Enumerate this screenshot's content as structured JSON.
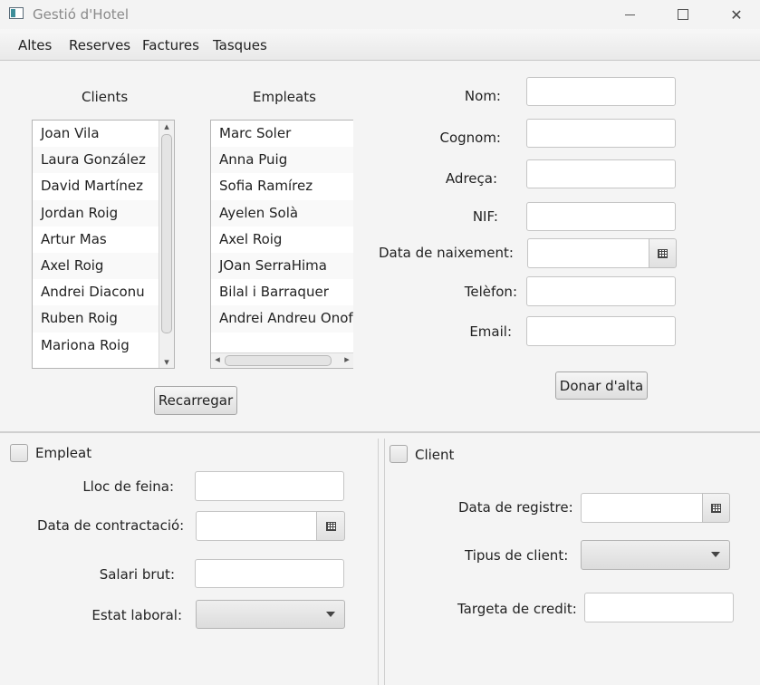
{
  "window": {
    "title": "Gestió d'Hotel"
  },
  "menu": [
    "Altes",
    "Reserves",
    "Factures",
    "Tasques"
  ],
  "clients": {
    "heading": "Clients",
    "items": [
      "Joan Vila",
      "Laura González",
      "David Martínez",
      "Jordan Roig",
      "Artur Mas",
      "Axel Roig",
      "Andrei Diaconu",
      "Ruben Roig",
      "Mariona Roig"
    ]
  },
  "employees": {
    "heading": "Empleats",
    "items": [
      "Marc Soler",
      "Anna Puig",
      "Sofia Ramírez",
      "Ayelen Solà",
      "Axel Roig",
      "JOan SerraHima",
      "Bilal i Barraquer",
      "Andrei Andreu Onofre"
    ]
  },
  "reload_button": "Recarregar",
  "form": {
    "nom_label": "Nom:",
    "cognom_label": "Cognom:",
    "adreca_label": "Adreça:",
    "nif_label": "NIF:",
    "birth_label": "Data de naixement:",
    "phone_label": "Telèfon:",
    "email_label": "Email:",
    "submit": "Donar d'alta"
  },
  "employee_panel": {
    "checkbox_label": "Empleat",
    "job_label": "Lloc de feina:",
    "hire_date_label": "Data de contractació:",
    "salary_label": "Salari brut:",
    "status_label": "Estat laboral:"
  },
  "client_panel": {
    "checkbox_label": "Client",
    "registry_label": "Data de registre:",
    "type_label": "Tipus de client:",
    "card_label": "Targeta de credit:"
  },
  "icons": {
    "app": "app-window-icon",
    "calendar": "calendar-icon",
    "dropdown": "chevron-down-icon"
  }
}
